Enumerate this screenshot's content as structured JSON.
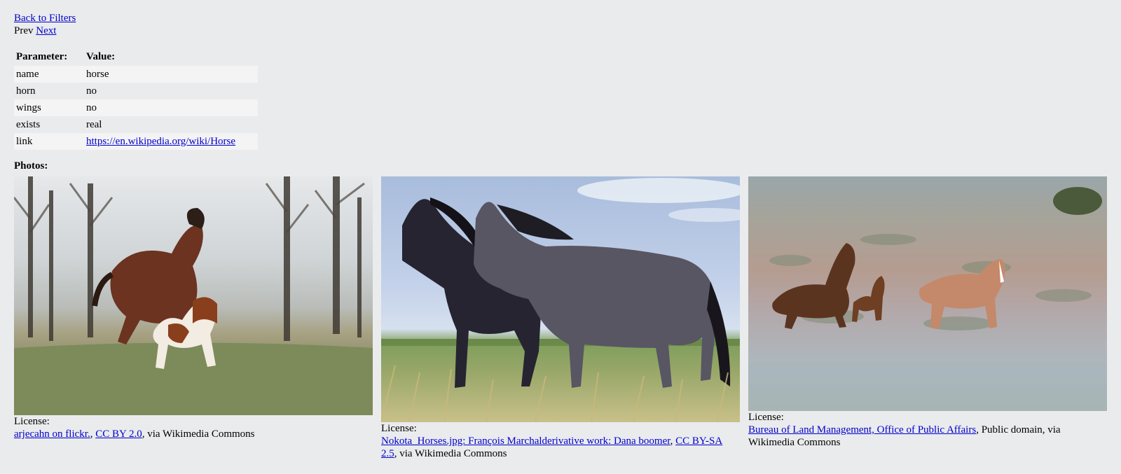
{
  "nav": {
    "back_label": "Back to Filters",
    "prev_label": "Prev",
    "next_label": "Next"
  },
  "params": {
    "header_param": "Parameter:",
    "header_value": "Value:",
    "rows": [
      {
        "key": "name",
        "value": "horse"
      },
      {
        "key": "horn",
        "value": "no"
      },
      {
        "key": "wings",
        "value": "no"
      },
      {
        "key": "exists",
        "value": "real"
      },
      {
        "key": "link",
        "value": "https://en.wikipedia.org/wiki/Horse"
      }
    ]
  },
  "photos_title": "Photos:",
  "photos": [
    {
      "license_label": "License:",
      "author": "arjecahn on flickr.",
      "sep": ", ",
      "license": "CC BY 2.0",
      "suffix": ", via Wikimedia Commons"
    },
    {
      "license_label": "License:",
      "author": "Nokota_Horses.jpg: François Marchalderivative work: Dana boomer",
      "sep": ", ",
      "license": "CC BY-SA 2.5",
      "suffix": ", via Wikimedia Commons"
    },
    {
      "license_label": "License:",
      "author": "Bureau of Land Management, Office of Public Affairs",
      "suffix": ", Public domain, via Wikimedia Commons"
    }
  ]
}
